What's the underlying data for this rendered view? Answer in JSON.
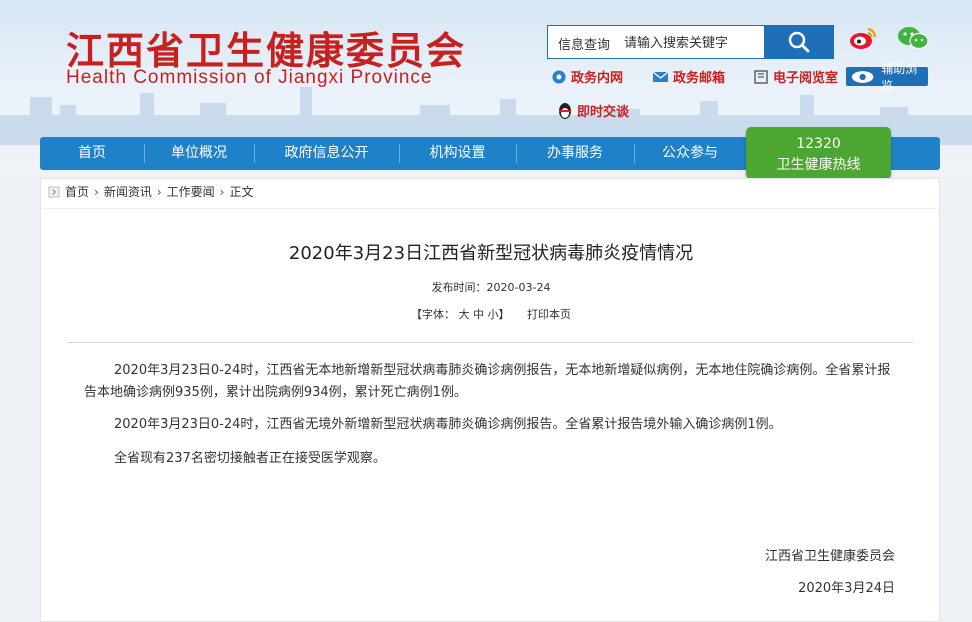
{
  "header": {
    "title_cn": "江西省卫生健康委员会",
    "title_en": "Health Commission of Jiangxi Province"
  },
  "search": {
    "scope_label": "信息查询",
    "placeholder": "请输入搜索关键字"
  },
  "quick_links": {
    "intranet": "政务内网",
    "mail": "政务邮箱",
    "reading_room": "电子阅览室",
    "assist": "辅助浏览",
    "chat": "即时交谈"
  },
  "nav": {
    "items": [
      "首页",
      "单位概况",
      "政府信息公开",
      "机构设置",
      "办事服务",
      "公众参与"
    ],
    "hotline_number": "12320",
    "hotline_label": "卫生健康热线"
  },
  "breadcrumb": [
    "首页",
    "新闻资讯",
    "工作要闻",
    "正文"
  ],
  "article": {
    "title": "2020年3月23日江西省新型冠状病毒肺炎疫情情况",
    "publish_label": "发布时间：",
    "publish_date": "2020-03-24",
    "font_label": "【字体：",
    "font_large": "大",
    "font_medium": "中",
    "font_small": "小",
    "font_close": "】",
    "print_label": "打印本页",
    "paragraphs": [
      "2020年3月23日0-24时，江西省无本地新增新型冠状病毒肺炎确诊病例报告，无本地新增疑似病例，无本地住院确诊病例。全省累计报告本地确诊病例935例，累计出院病例934例，累计死亡病例1例。",
      "2020年3月23日0-24时，江西省无境外新增新型冠状病毒肺炎确诊病例报告。全省累计报告境外输入确诊病例1例。",
      "全省现有237名密切接触者正在接受医学观察。"
    ],
    "signature": "江西省卫生健康委员会",
    "sign_date": "2020年3月24日"
  },
  "colors": {
    "brand_red": "#c8201f",
    "nav_blue": "#1f82c9",
    "search_blue": "#1f6fb8",
    "hotline_green": "#4ea632"
  }
}
